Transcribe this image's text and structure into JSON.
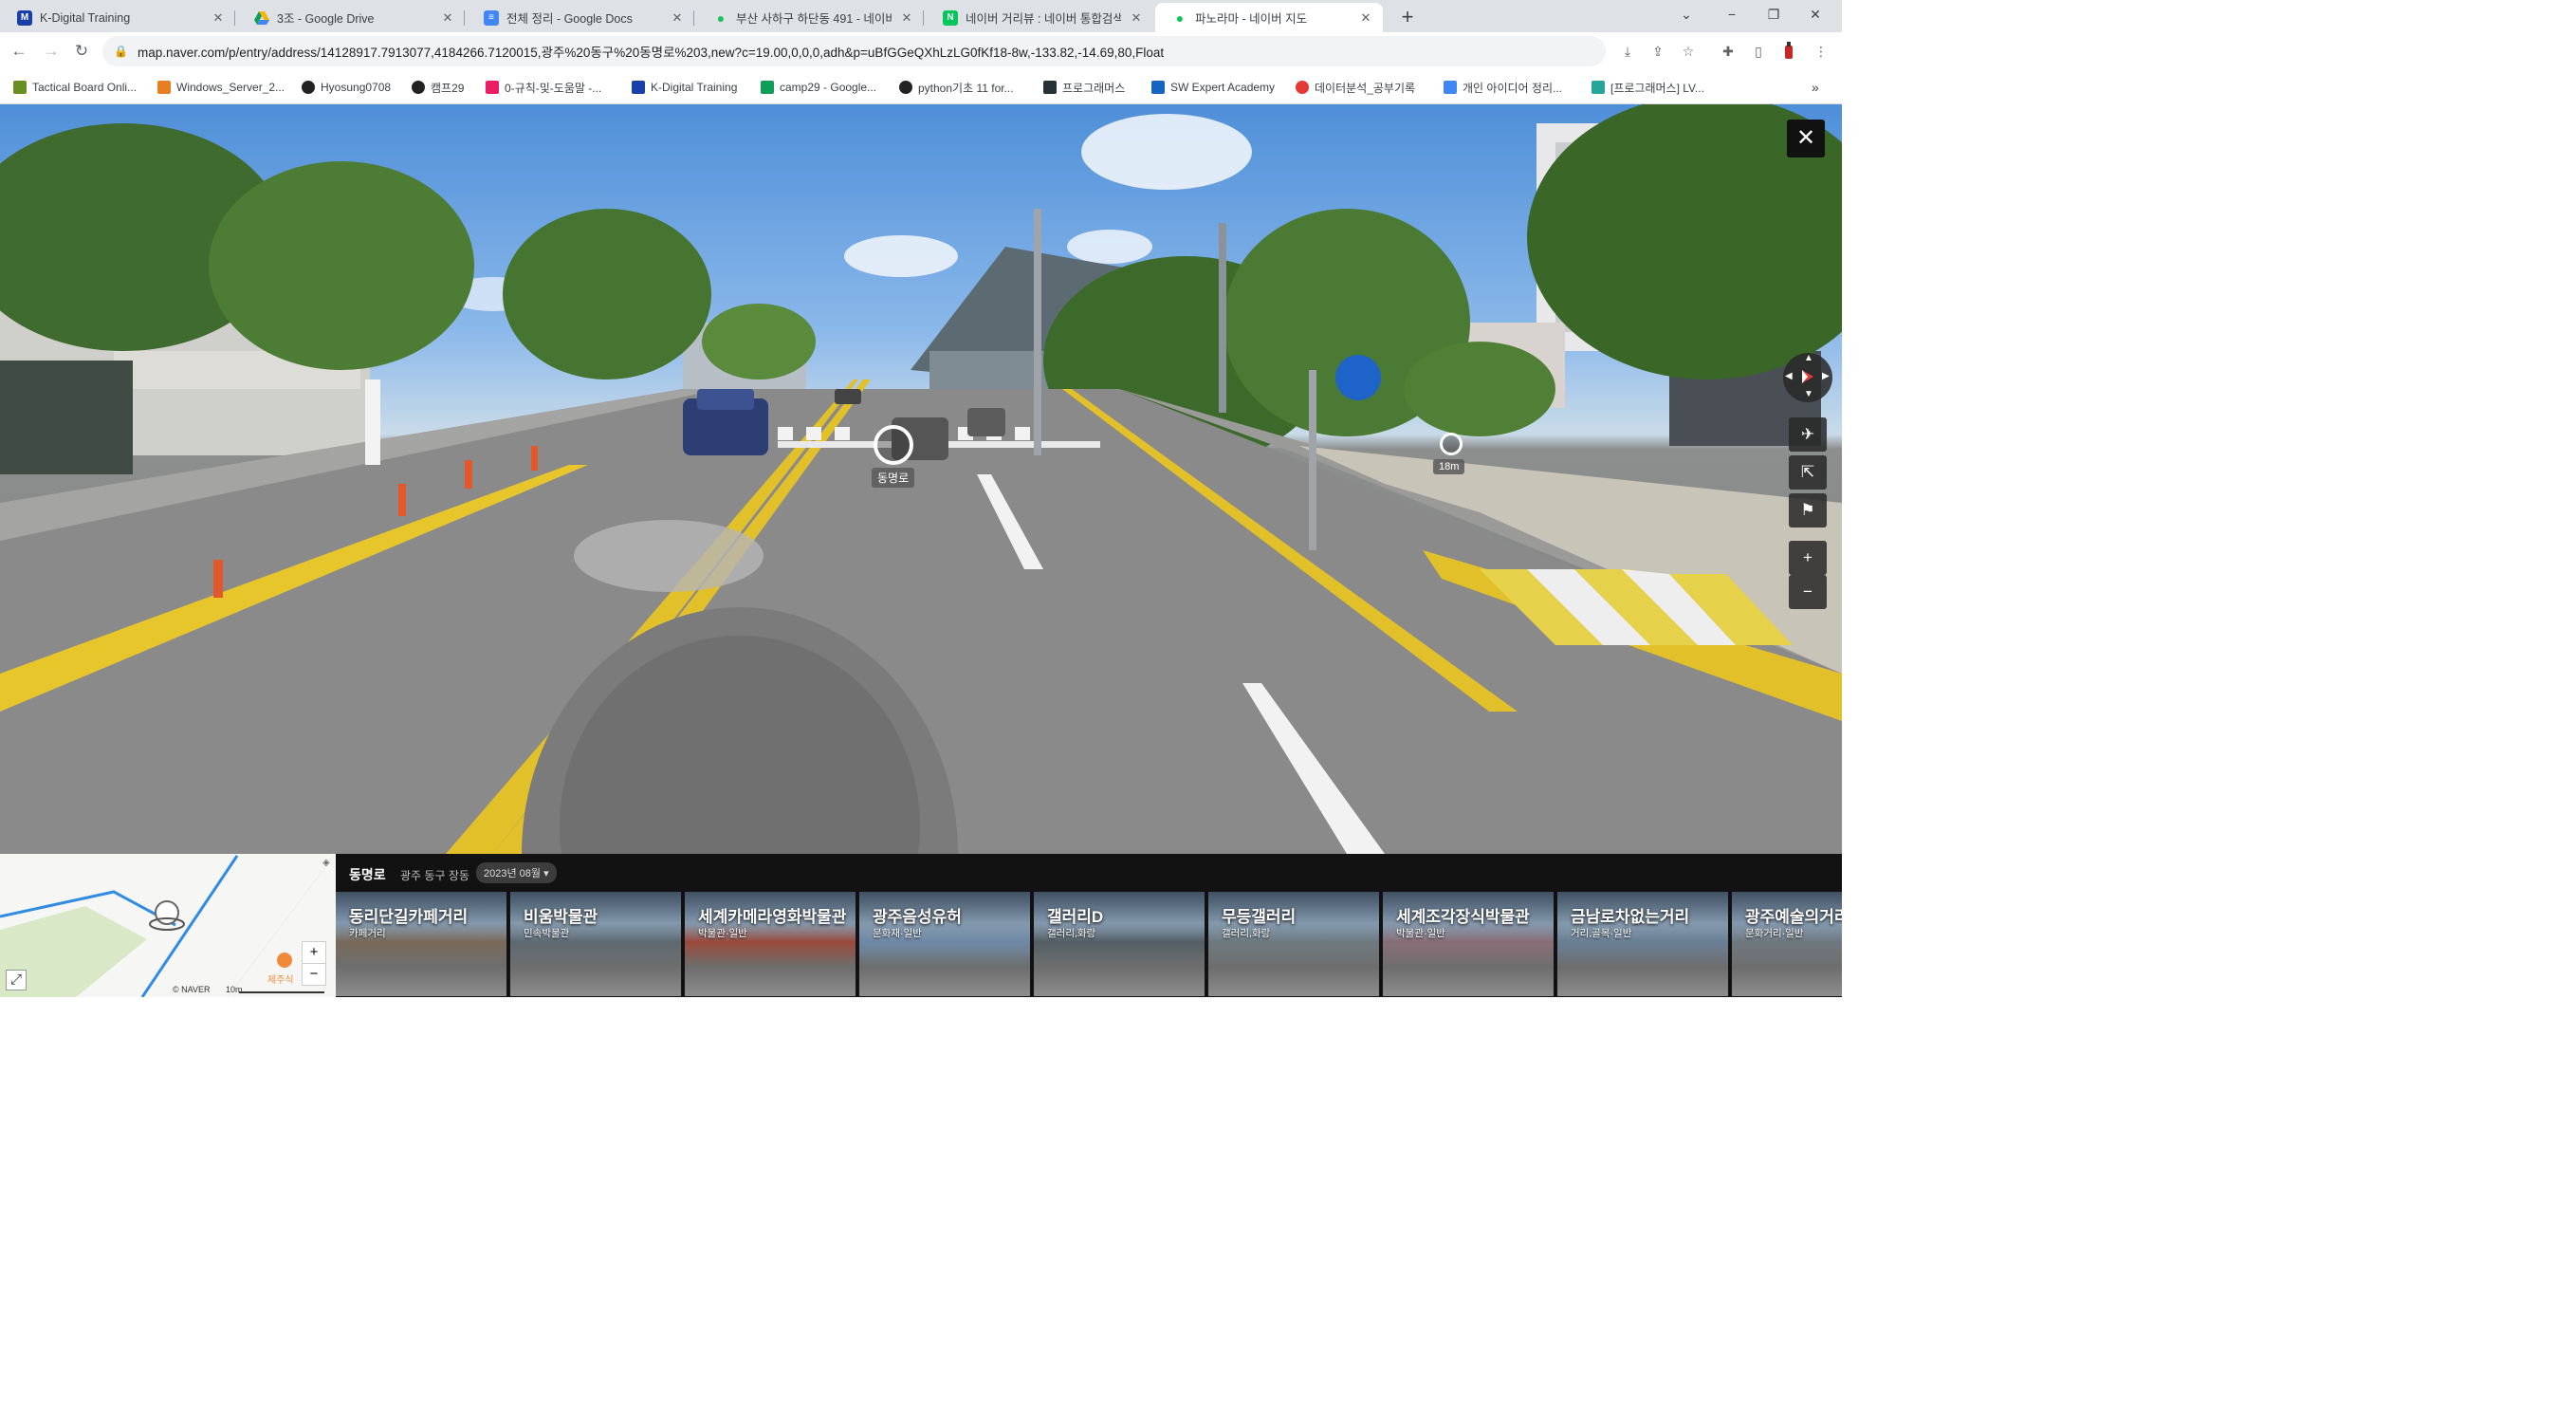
{
  "tabs": [
    {
      "title": "K-Digital Training",
      "favicon": "M",
      "color": "#1a3fa8"
    },
    {
      "title": "3조 - Google Drive",
      "favicon": "drive-icon",
      "color": "#f4b400"
    },
    {
      "title": "전체 정리 - Google Docs",
      "favicon": "docs-icon",
      "color": "#4285f4"
    },
    {
      "title": "부산 사하구 하단동 491 - 네이버",
      "favicon": "naver-map-icon",
      "color": "#16c35a"
    },
    {
      "title": "네이버 거리뷰 : 네이버 통합검색",
      "favicon": "N",
      "color": "#03c75a"
    },
    {
      "title": "파노라마 - 네이버 지도",
      "favicon": "naver-map-icon",
      "color": "#16c35a"
    }
  ],
  "address_bar": {
    "url": "map.naver.com/p/entry/address/14128917.7913077,4184266.7120015,광주%20동구%20동명로%203,new?c=19.00,0,0,0,adh&p=uBfGGeQXhLzLG0fKf18-8w,-133.82,-14.69,80,Float"
  },
  "bookmarks": [
    {
      "label": "Tactical Board Onli...",
      "color": "#6b8e23"
    },
    {
      "label": "Windows_Server_2...",
      "color": "#e67e22"
    },
    {
      "label": "Hyosung0708",
      "color": "#222222"
    },
    {
      "label": "캠프29",
      "color": "#222222"
    },
    {
      "label": "0-규칙-및-도움말 -...",
      "color": "#e91e63"
    },
    {
      "label": "K-Digital Training",
      "color": "#1a3fa8"
    },
    {
      "label": "camp29 - Google...",
      "color": "#0f9d58"
    },
    {
      "label": "python기초 11 for...",
      "color": "#222222"
    },
    {
      "label": "프로그래머스",
      "color": "#263238"
    },
    {
      "label": "SW Expert Academy",
      "color": "#1565c0"
    },
    {
      "label": "데이터분석_공부기록",
      "color": "#e53935"
    },
    {
      "label": "개인 아이디어 정리...",
      "color": "#4285f4"
    },
    {
      "label": "[프로그래머스] LV...",
      "color": "#26a69a"
    }
  ],
  "panorama": {
    "road_label": "동명로",
    "distance_label": "18m"
  },
  "minimap": {
    "attribution": "© NAVER",
    "scale": "10m",
    "poi": "제주식"
  },
  "location": {
    "name": "동명로",
    "address": "광주 동구 장동",
    "date": "2023년 08월"
  },
  "places": [
    {
      "name": "동리단길카페거리",
      "category": "카페거리",
      "tone": "#7a6a5a"
    },
    {
      "name": "비움박물관",
      "category": "민속박물관",
      "tone": "#5f6a72"
    },
    {
      "name": "세계카메라영화박물관",
      "category": "박물관·일반",
      "tone": "#9a4a3a"
    },
    {
      "name": "광주음성유허",
      "category": "문화재·일반",
      "tone": "#6f8aa8"
    },
    {
      "name": "갤러리D",
      "category": "갤러리,화랑",
      "tone": "#556066"
    },
    {
      "name": "무등갤러리",
      "category": "갤러리,화랑",
      "tone": "#6e7a80"
    },
    {
      "name": "세계조각장식박물관",
      "category": "박물관·일반",
      "tone": "#8a6e78"
    },
    {
      "name": "금남로차없는거리",
      "category": "거리,골목·일반",
      "tone": "#6a8095"
    },
    {
      "name": "광주예술의거리",
      "category": "문화거리·일반",
      "tone": "#707880"
    }
  ]
}
